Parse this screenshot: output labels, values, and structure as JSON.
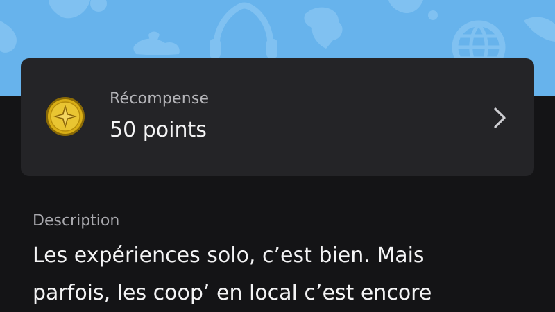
{
  "colors": {
    "banner": "#67b3ec",
    "card": "#242427",
    "page_background": "#141416",
    "coin_gold": "#d9ae16"
  },
  "banner": {
    "icons": [
      "game-icon",
      "headphones-icon",
      "globe-icon",
      "character-icon"
    ]
  },
  "reward": {
    "label": "Récompense",
    "value": "50 points",
    "icon": "gold-trophy-icon",
    "chevron_icon": "chevron-right-icon"
  },
  "description": {
    "label": "Description",
    "lines": [
      "Les expériences solo, c’est bien. Mais",
      "parfois, les coop’ en local c’est encore"
    ]
  }
}
